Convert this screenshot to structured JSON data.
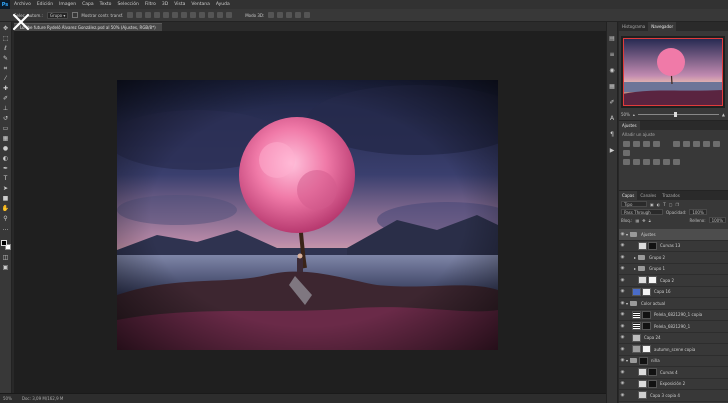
{
  "app": {
    "logo": "Ps"
  },
  "menu": [
    "Archivo",
    "Edición",
    "Imagen",
    "Capa",
    "Texto",
    "Selección",
    "Filtro",
    "3D",
    "Vista",
    "Ventana",
    "Ayuda"
  ],
  "options": {
    "autoselect_label": "Selec. autom.:",
    "autoselect_value": "Grupo",
    "show_transform_label": "Mostrar contr. transf.",
    "mode_3d_label": "Modo 3D:"
  },
  "document": {
    "tab_title": "Lo the future Rydeló Álvarez González.psd al 50% (Ajustes, RGB/8*)"
  },
  "statusbar": {
    "zoom": "50%",
    "doc_info": "Doc: 3,09 M/162,9 M"
  },
  "panels": {
    "nav_tabs": [
      "Histograma",
      "Navegador"
    ],
    "nav_zoom": "50%",
    "adjustments_title": "Ajustes",
    "adjustments_subtitle": "Añadir un ajuste",
    "layer_tabs": [
      "Capas",
      "Canales",
      "Trazados"
    ],
    "kind_label": "Tipo",
    "blend_mode": "Pass Through",
    "opacity_label": "Opacidad:",
    "opacity_value": "100%",
    "lock_label": "Bloq.:",
    "fill_label": "Relleno:",
    "fill_value": "100%"
  },
  "layers": [
    {
      "name": "Ajustes",
      "type": "group",
      "selected": true
    },
    {
      "name": "Curvas 13",
      "type": "adjust"
    },
    {
      "name": "Grupo 2",
      "type": "group"
    },
    {
      "name": "Grupo 1",
      "type": "group"
    },
    {
      "name": "Capa 2",
      "type": "layer"
    },
    {
      "name": "Capa 16",
      "type": "layer"
    },
    {
      "name": "Color actual",
      "type": "group"
    },
    {
      "name": "Pelela_6821290_1 copia",
      "type": "layer"
    },
    {
      "name": "Pelela_6821290_1",
      "type": "layer"
    },
    {
      "name": "Capa 24",
      "type": "layer"
    },
    {
      "name": "autumn_scene copia",
      "type": "layer"
    },
    {
      "name": "niña",
      "type": "group"
    },
    {
      "name": "Curvas 4",
      "type": "adjust"
    },
    {
      "name": "Exposición 2",
      "type": "adjust"
    },
    {
      "name": "Capa 3 copia 4",
      "type": "layer"
    }
  ],
  "colors": {
    "accent_frame": "#e23b3b",
    "tree_pink": "#f07aa8"
  }
}
